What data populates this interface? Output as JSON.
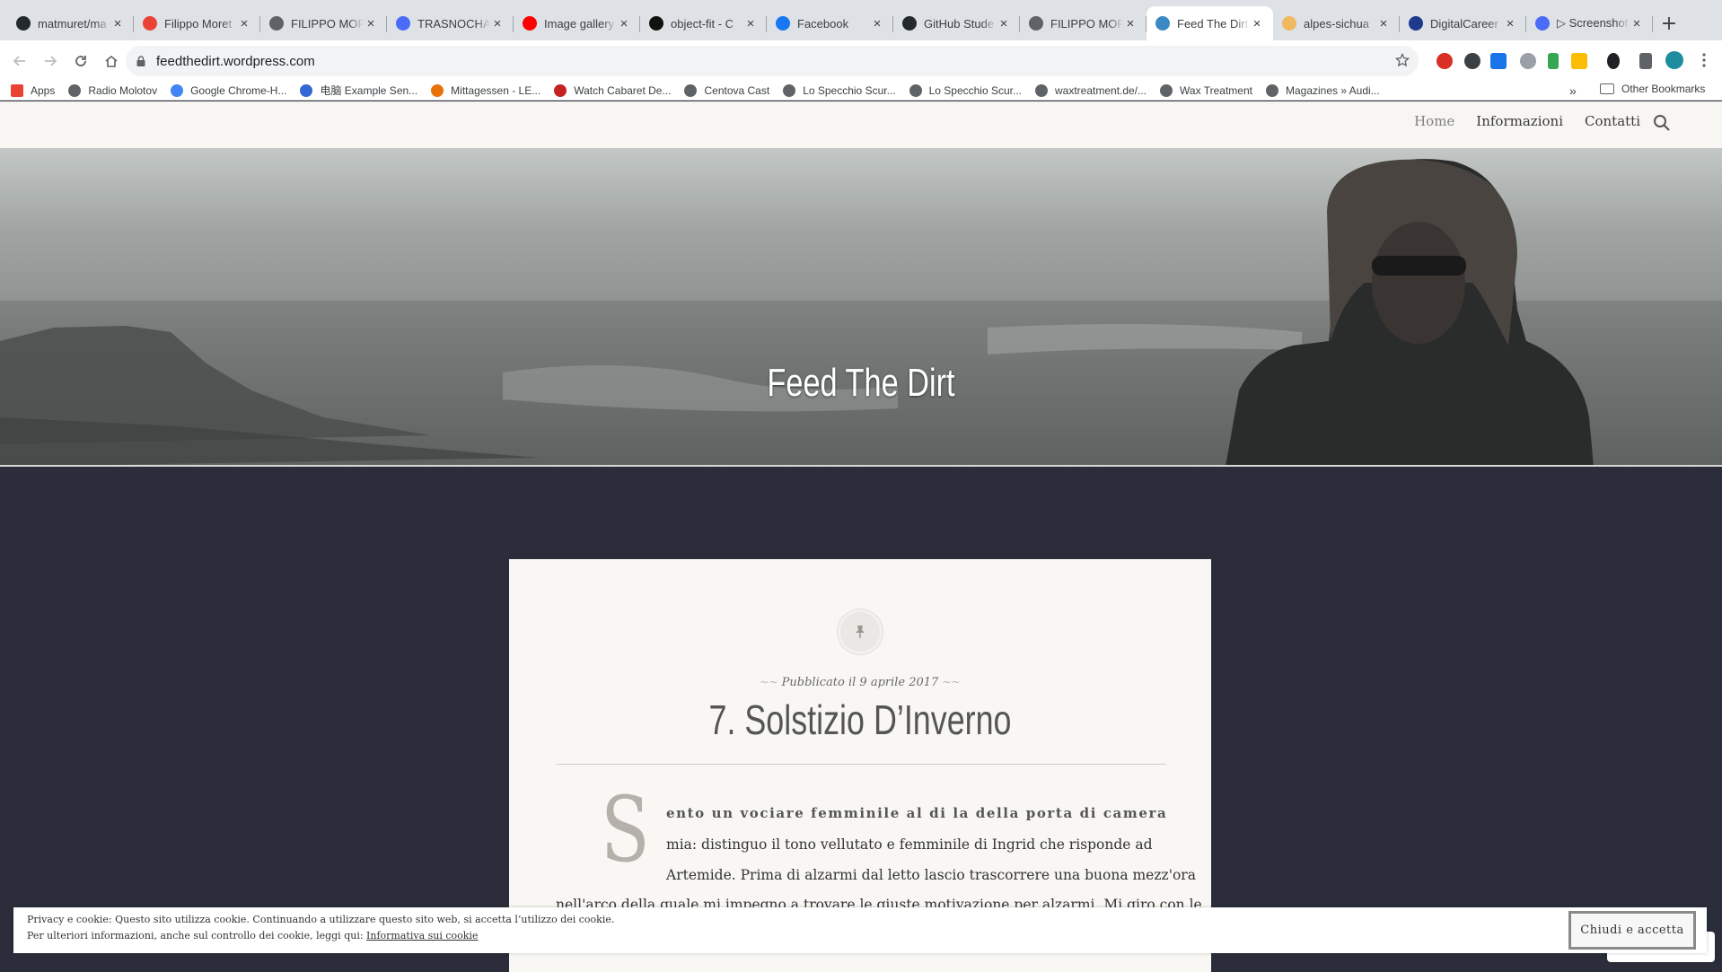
{
  "browser": {
    "tabs": [
      {
        "title": "matmuret/ma",
        "icon": "github-icon",
        "color": "#24292e"
      },
      {
        "title": "Filippo Moret",
        "icon": "gmail-icon",
        "color": "#ea4335"
      },
      {
        "title": "FILIPPO MOR",
        "icon": "globe-icon",
        "color": "#5f6368"
      },
      {
        "title": "TRASNOCHA",
        "icon": "c-logo-icon",
        "color": "#4a6cf7"
      },
      {
        "title": "Image gallery",
        "icon": "youtube-icon",
        "color": "#ff0000"
      },
      {
        "title": "object-fit - C",
        "icon": "codepen-icon",
        "color": "#111111"
      },
      {
        "title": "Facebook",
        "icon": "facebook-icon",
        "color": "#1877f2"
      },
      {
        "title": "GitHub Stude",
        "icon": "github-icon",
        "color": "#24292e"
      },
      {
        "title": "FILIPPO MOR",
        "icon": "globe-icon",
        "color": "#5f6368"
      },
      {
        "title": "Feed The Dirt",
        "icon": "wordpress-icon",
        "color": "#3b8ac4",
        "active": true
      },
      {
        "title": "alpes-sichua",
        "icon": "diamond-icon",
        "color": "#f0b860"
      },
      {
        "title": "DigitalCareer",
        "icon": "dc-logo-icon",
        "color": "#1e3a8a"
      },
      {
        "title": "▷ Screenshot",
        "icon": "screenshot-icon",
        "color": "#4a6cf7"
      }
    ],
    "address": "feedthedirt.wordpress.com",
    "bookmarks": [
      {
        "label": "Apps",
        "icon": "apps-grid-icon",
        "color": "#e94235"
      },
      {
        "label": "Radio Molotov",
        "icon": "globe-icon",
        "color": "#5f6368"
      },
      {
        "label": "Google Chrome-H...",
        "icon": "google-icon",
        "color": "#4285f4"
      },
      {
        "label": "电脑 Example Sen...",
        "icon": "site-icon",
        "color": "#3367d6"
      },
      {
        "label": "Mittagessen - LE...",
        "icon": "site-icon",
        "color": "#e8710a"
      },
      {
        "label": "Watch Cabaret De...",
        "icon": "eye-icon",
        "color": "#c5221f"
      },
      {
        "label": "Centova Cast",
        "icon": "globe-icon",
        "color": "#5f6368"
      },
      {
        "label": "Lo Specchio Scur...",
        "icon": "globe-icon",
        "color": "#5f6368"
      },
      {
        "label": "Lo Specchio Scur...",
        "icon": "globe-icon",
        "color": "#5f6368"
      },
      {
        "label": "waxtreatment.de/...",
        "icon": "globe-icon",
        "color": "#5f6368"
      },
      {
        "label": "Wax Treatment",
        "icon": "globe-icon",
        "color": "#5f6368"
      },
      {
        "label": "Magazines » Audi...",
        "icon": "globe-icon",
        "color": "#5f6368"
      }
    ],
    "bookmarks_more": "»",
    "other_bookmarks": "Other Bookmarks"
  },
  "site": {
    "nav": {
      "home": "Home",
      "info": "Informazioni",
      "contact": "Contatti"
    },
    "title": "Feed The Dirt",
    "post": {
      "meta": "Pubblicato il 9 aprile 2017",
      "title": "7. Solstizio D’Inverno",
      "dropcap": "S",
      "line1": "ento un vociare femminile al di la della porta di camera",
      "line2": "mia: distinguo il tono vellutato e femminile di Ingrid che risponde ad",
      "line3": "Artemide. Prima di alzarmi dal letto lascio trascorrere una buona mezz'ora",
      "line4": "nell'arco della quale mi impegno a trovare le giuste motivazione per alzarmi. Mi giro con le"
    },
    "cookie": {
      "text1": "Privacy e cookie: Questo sito utilizza cookie. Continuando a utilizzare questo sito web, si accetta l’utilizzo dei cookie.",
      "text2_prefix": "Per ulteriori informazioni, anche sul controllo dei cookie, leggi qui: ",
      "link": "Informativa sui cookie",
      "button": "Chiudi e accetta"
    }
  }
}
